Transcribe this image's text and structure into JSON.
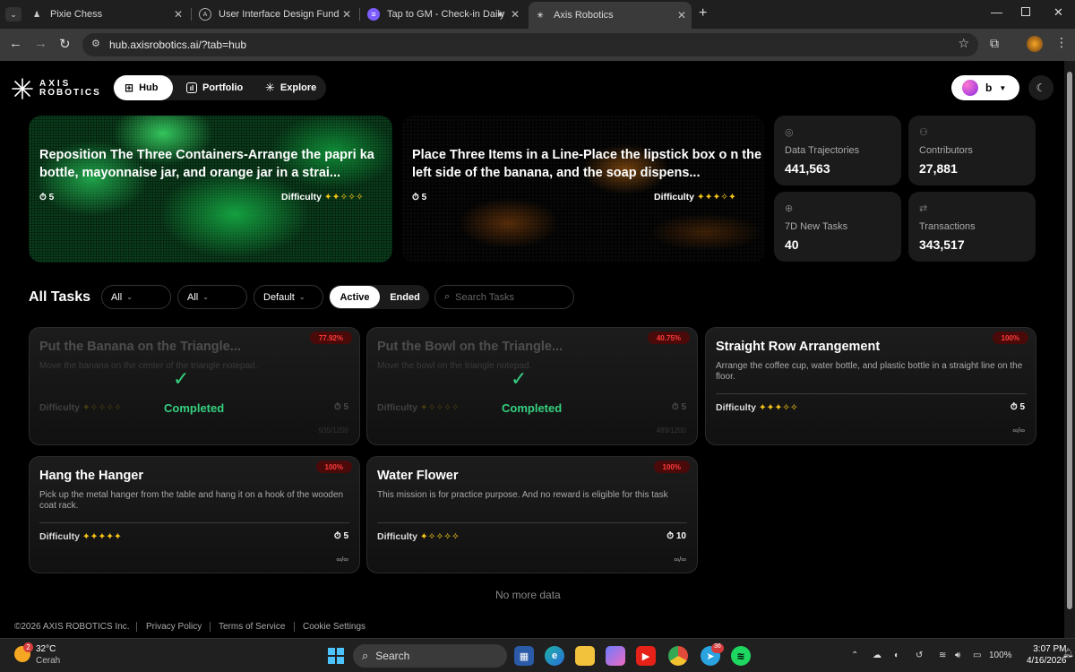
{
  "browser": {
    "tabs": [
      {
        "title": "Pixie Chess",
        "favicon": "chess-pawn-icon"
      },
      {
        "title": "User Interface Design Fundame",
        "favicon": "framer-icon"
      },
      {
        "title": "Tap to GM - Check-in Daily",
        "favicon": "gm-icon"
      },
      {
        "title": "Axis Robotics",
        "favicon": "axis-robotics-icon"
      }
    ],
    "new_tab": "+",
    "url": "hub.axisrobotics.ai/?tab=hub"
  },
  "app": {
    "logo_line1": "AXIS",
    "logo_line2": "ROBOTICS",
    "nav": [
      {
        "label": "Hub",
        "icon": "grid-icon",
        "active": true
      },
      {
        "label": "Portfolio",
        "icon": "chart-icon",
        "active": false
      },
      {
        "label": "Explore",
        "icon": "sparkle-icon",
        "active": false
      }
    ],
    "user_initial": "b"
  },
  "featured": [
    {
      "title": "Reposition The Three Containers-Arrange the papri ka bottle, mayonnaise jar, and orange jar in a strai...",
      "time": "5",
      "difficulty_label": "Difficulty",
      "stars": "✦✦✧✧✧",
      "accent": "#35c46a"
    },
    {
      "title": "Place Three Items in a Line-Place the lipstick box o n the left side of the banana, and the soap dispens...",
      "time": "5",
      "difficulty_label": "Difficulty",
      "stars": "✦✦✦✧✦",
      "accent": "#e58a1f"
    }
  ],
  "stats": [
    {
      "label": "Data Trajectories",
      "value": "441,563",
      "icon": "target-icon"
    },
    {
      "label": "Contributors",
      "value": "27,881",
      "icon": "users-icon"
    },
    {
      "label": "7D New Tasks",
      "value": "40",
      "icon": "plus-circle-icon"
    },
    {
      "label": "Transactions",
      "value": "343,517",
      "icon": "transfer-icon"
    }
  ],
  "tasks_section": {
    "title": "All Tasks",
    "filters": [
      "All",
      "All",
      "Default"
    ],
    "status_active": "Active",
    "status_ended": "Ended",
    "search_placeholder": "Search Tasks"
  },
  "tasks": [
    {
      "title": "Put the Banana on the Triangle...",
      "desc": "Move the banana on the center of the triangle notepad.",
      "badge": "77.92%",
      "difficulty_label": "Difficulty",
      "stars": "✦✧✧✧✧",
      "time": "5",
      "foot": "935/1200",
      "completed": true,
      "completed_label": "Completed"
    },
    {
      "title": "Put the Bowl on the Triangle...",
      "desc": "Move the bowl on the triangle notepad.",
      "badge": "40.75%",
      "difficulty_label": "Difficulty",
      "stars": "✦✧✧✧✧",
      "time": "5",
      "foot": "489/1200",
      "completed": true,
      "completed_label": "Completed"
    },
    {
      "title": "Straight Row Arrangement",
      "desc": "Arrange the coffee cup, water bottle, and plastic bottle in a straight line on the floor.",
      "badge": "100%",
      "difficulty_label": "Difficulty",
      "stars": "✦✦✦✧✧",
      "time": "5",
      "foot": "∞/∞",
      "completed": false
    },
    {
      "title": "Hang the Hanger",
      "desc": "Pick up the metal hanger from the table and hang it on a hook of the wooden coat rack.",
      "badge": "100%",
      "difficulty_label": "Difficulty",
      "stars": "✦✦✦✦✦",
      "time": "5",
      "foot": "∞/∞",
      "completed": false
    },
    {
      "title": "Water Flower",
      "desc": "This mission is for practice purpose. And no reward is eligible for this task",
      "badge": "100%",
      "difficulty_label": "Difficulty",
      "stars": "✦✧✧✧✧",
      "time": "10",
      "foot": "∞/∞",
      "completed": false
    }
  ],
  "no_more": "No more data",
  "footer": {
    "copyright": "©2026 AXIS ROBOTICS Inc.",
    "privacy": "Privacy Policy",
    "terms": "Terms of Service",
    "cookies": "Cookie Settings"
  },
  "taskbar": {
    "weather_temp": "32°C",
    "weather_desc": "Cerah",
    "weather_badge": "2",
    "search": "Search",
    "battery": "100%",
    "time": "3:07 PM",
    "date": "4/16/2026",
    "telegram_badge": "36"
  }
}
